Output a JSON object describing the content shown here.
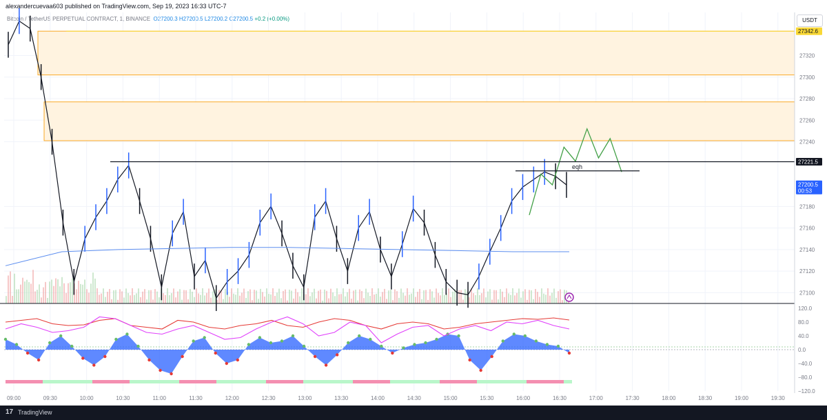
{
  "header": {
    "published_by": "alexandercuevaa603 published on TradingView.com, Sep 19, 2023 16:33 UTC-7",
    "symbol": "Bitcoin / TetherUS PERPETUAL CONTRACT, 1, BINANCE",
    "ohlc": {
      "O": "O27200.3",
      "H": "H27200.5",
      "L": "L27200.2",
      "C": "C27200.5",
      "change": "+0.2 (+0.00%)"
    },
    "currency": "USDT"
  },
  "footer": {
    "brand": "TradingView",
    "logo_glyph": "17"
  },
  "colors": {
    "up": "#2962ff",
    "down": "#131722",
    "zone_fill": "#fff3e0",
    "zone_border": "#f9a825",
    "projection": "#43a047",
    "vwap": "#5b8def"
  },
  "chart_data": [
    {
      "type": "line",
      "title": "",
      "price_axis": {
        "ylim": [
          27090,
          27360
        ],
        "ticks": [
          27300,
          27280,
          27260,
          27240,
          27180,
          27160,
          27140,
          27120,
          27100,
          27320
        ]
      },
      "time_axis": {
        "labels": [
          "09:00",
          "09:30",
          "10:00",
          "10:30",
          "11:00",
          "11:30",
          "12:00",
          "12:30",
          "13:00",
          "13:30",
          "14:00",
          "14:30",
          "15:00",
          "15:30",
          "16:00",
          "16:30",
          "17:00",
          "17:30",
          "18:00",
          "18:30",
          "19:00",
          "19:30"
        ]
      },
      "series": [
        {
          "values": [
            27330,
            27352,
            27345,
            27300,
            27240,
            27165,
            27110,
            27150,
            27170,
            27185,
            27205,
            27218,
            27185,
            27150,
            27105,
            27155,
            27175,
            27115,
            27130,
            27095,
            27110,
            27120,
            27135,
            27165,
            27180,
            27155,
            27125,
            27105,
            27170,
            27185,
            27150,
            27120,
            27160,
            27175,
            27140,
            27115,
            27145,
            27178,
            27165,
            27135,
            27110,
            27100,
            27098,
            27115,
            27138,
            27160,
            27185,
            27198,
            27205,
            27212,
            27208,
            27200
          ]
        },
        {
          "name": "vwap",
          "values": [
            27125,
            27138,
            27140,
            27141,
            27142,
            27142,
            27141,
            27140,
            27139,
            27138,
            27138
          ]
        },
        {
          "name": "projection",
          "values": [
            27172,
            27210,
            27200,
            27235,
            27222,
            27252,
            27225,
            27243,
            27212
          ]
        }
      ],
      "levels": [
        {
          "label": "27342.6",
          "value": 27342.6
        },
        {
          "label": "27221.5",
          "value": 27221.5
        },
        {
          "label": "27200.5",
          "value": 27200.5,
          "countdown": "00:53"
        },
        {
          "label": "eqh",
          "value": 27213
        }
      ],
      "zones": [
        {
          "from": 27302,
          "to": 27342.6
        },
        {
          "from": 27241,
          "to": 27277
        }
      ]
    },
    {
      "type": "area",
      "title": "",
      "ylim": [
        -120,
        120
      ],
      "ticks": [
        120,
        80,
        40,
        0,
        -40,
        -80,
        -120
      ],
      "tick_labels": [
        "120.0",
        "80.0",
        "40.0",
        "0.0",
        "−40.0",
        "−80.0",
        "−120.0"
      ],
      "series": [
        {
          "name": "oscillator",
          "values": [
            30,
            15,
            -10,
            -30,
            20,
            40,
            10,
            -25,
            -45,
            -20,
            30,
            45,
            10,
            -30,
            -60,
            -70,
            -20,
            25,
            35,
            -10,
            -40,
            -30,
            15,
            35,
            20,
            25,
            40,
            10,
            -20,
            -45,
            -15,
            20,
            40,
            30,
            10,
            -10,
            5,
            15,
            20,
            30,
            45,
            40,
            -30,
            -60,
            -20,
            25,
            45,
            40,
            25,
            15,
            10,
            -10
          ]
        },
        {
          "name": "red line",
          "values": [
            80,
            85,
            90,
            75,
            70,
            72,
            85,
            90,
            70,
            65,
            60,
            85,
            80,
            65,
            60,
            70,
            75,
            85,
            70,
            65,
            80,
            90,
            85,
            70,
            60,
            75,
            80,
            75,
            60,
            65,
            75,
            80,
            85,
            90,
            88,
            92,
            86
          ]
        },
        {
          "name": "magenta line",
          "values": [
            60,
            75,
            65,
            50,
            55,
            65,
            95,
            90,
            70,
            50,
            45,
            60,
            70,
            50,
            30,
            35,
            60,
            80,
            95,
            75,
            40,
            50,
            80,
            70,
            20,
            45,
            65,
            70,
            40,
            60,
            70,
            55,
            80,
            75,
            85,
            70,
            60
          ]
        }
      ]
    }
  ]
}
